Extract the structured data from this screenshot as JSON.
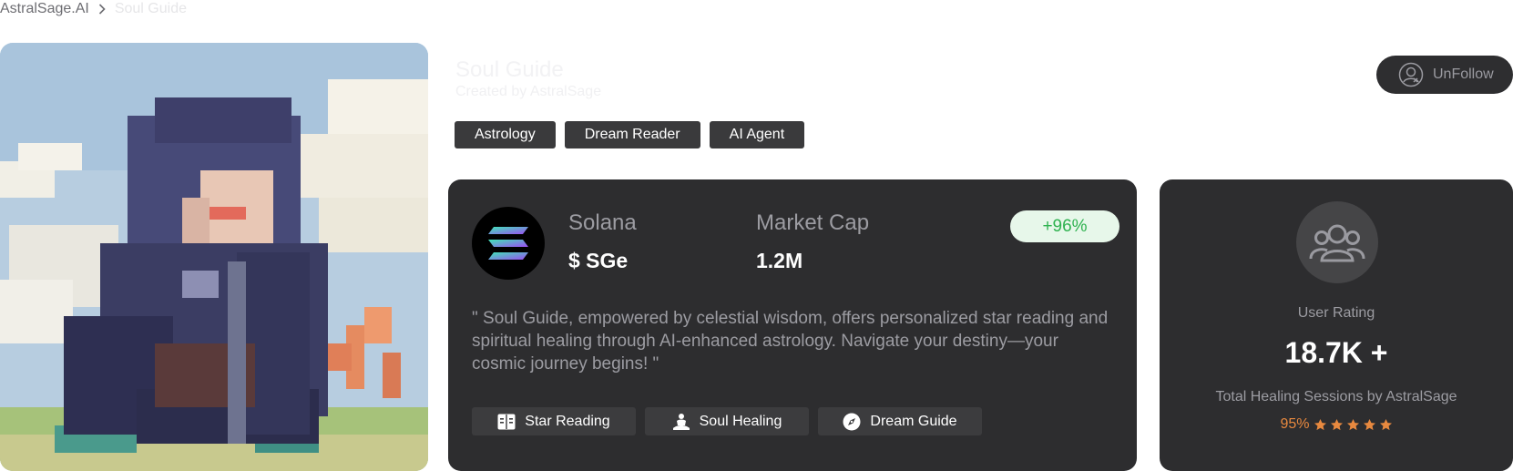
{
  "breadcrumb": {
    "home": "AstralSage.AI",
    "current": "Soul Guide"
  },
  "agent": {
    "title": "Soul Guide",
    "subtitle": "Created by AstralSage",
    "unfollow_label": "UnFollow"
  },
  "tags": [
    "Astrology",
    "Dream Reader",
    "AI Agent"
  ],
  "token": {
    "chain_label": "Solana",
    "ticker": "$ SGe",
    "market_cap_label": "Market Cap",
    "market_cap_value": "1.2M",
    "change": "+96%",
    "description": "\" Soul Guide, empowered by celestial wisdom, offers personalized star reading and spiritual healing through AI-enhanced astrology. Navigate your destiny—your cosmic journey begins! \"",
    "features": [
      {
        "label": "Star Reading",
        "icon": "book-icon"
      },
      {
        "label": "Soul Healing",
        "icon": "meditation-icon"
      },
      {
        "label": "Dream Guide",
        "icon": "compass-icon"
      }
    ]
  },
  "stats": {
    "rating_label": "User Rating",
    "rating_value": "18.7K +",
    "sessions_label": "Total Healing Sessions by AstralSage",
    "percent": "95%",
    "stars": 5
  },
  "colors": {
    "card_bg": "#2d2d2f",
    "positive": "#2fb250",
    "star": "#e8893f"
  }
}
